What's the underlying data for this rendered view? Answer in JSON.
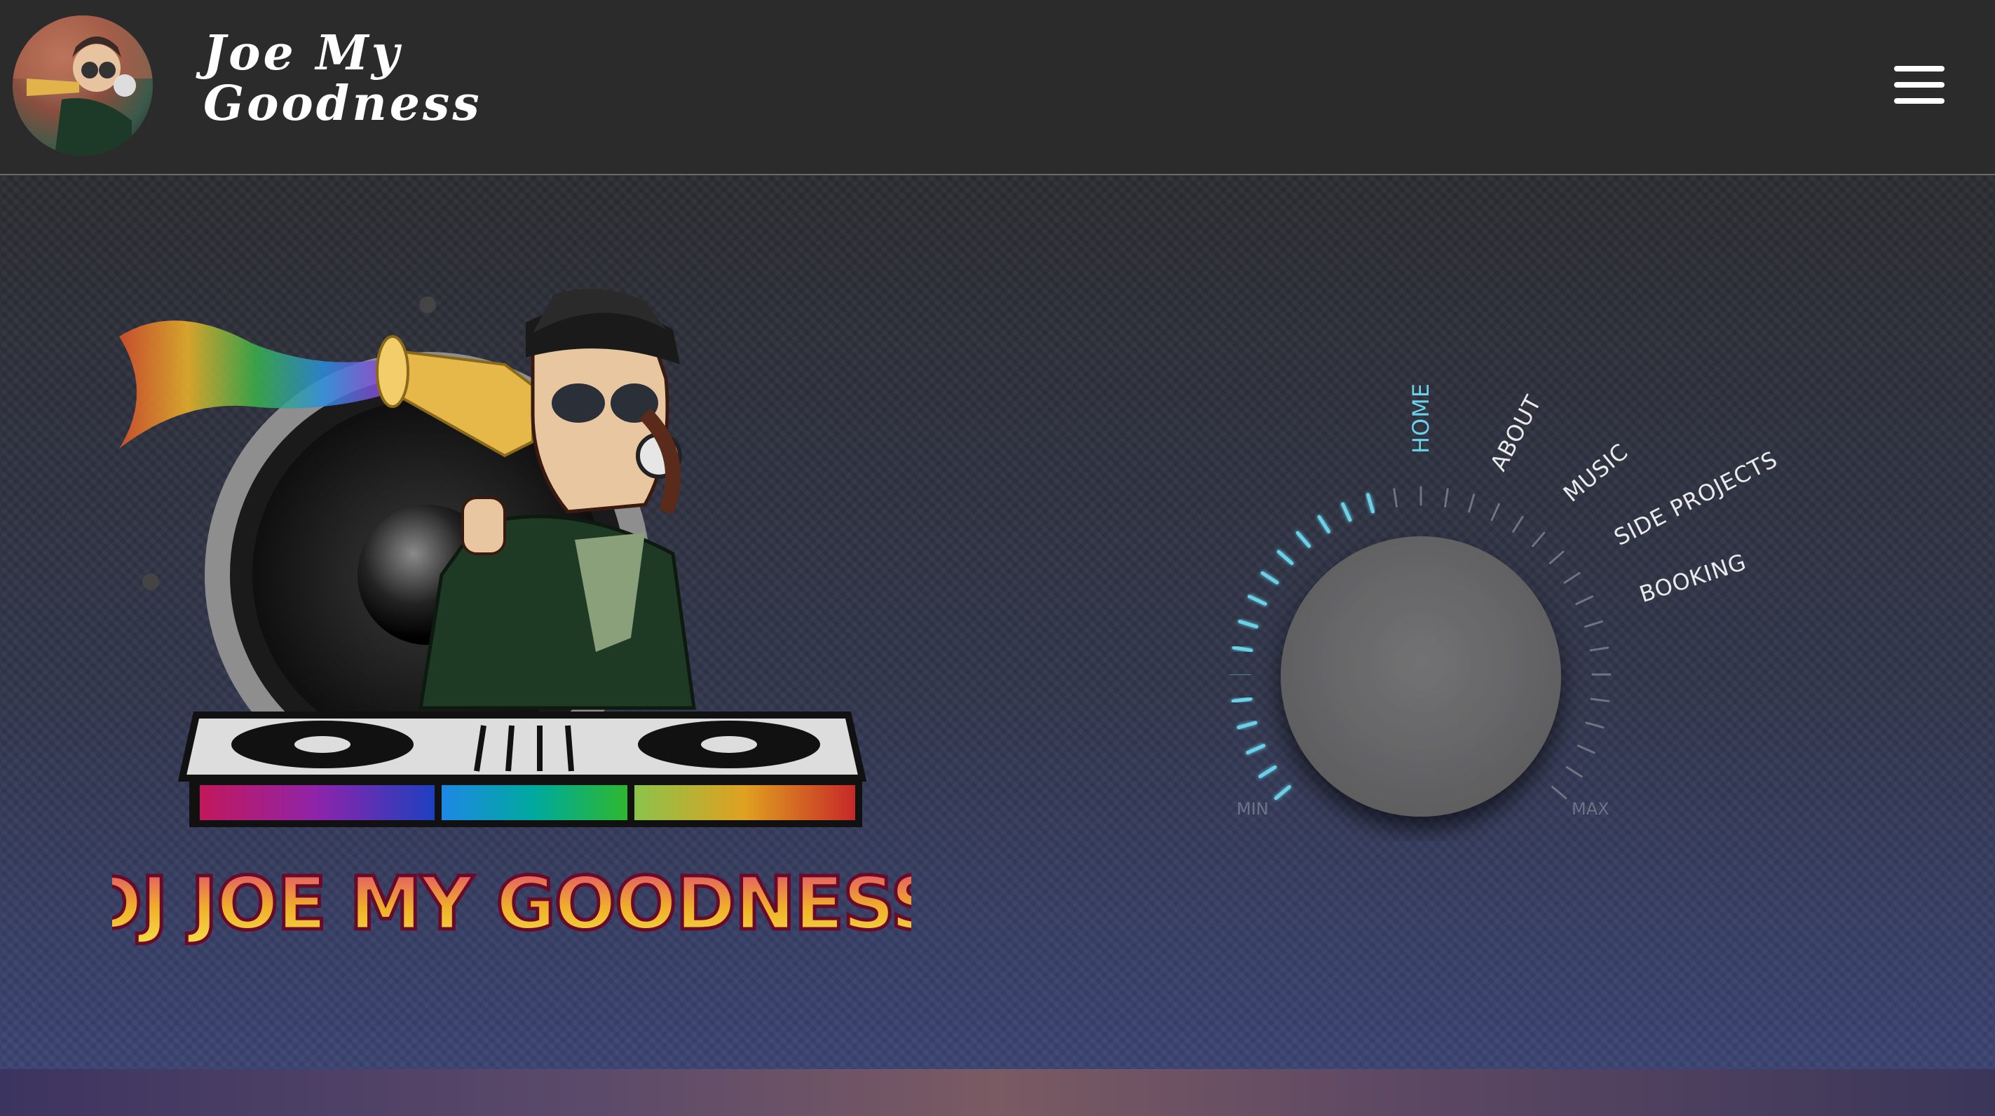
{
  "header": {
    "brand_line1": "Joe My",
    "brand_line2": "Goodness",
    "menu_icon": "hamburger-menu-icon"
  },
  "hero": {
    "logo_text": "DJ JOE MY GOODNESS"
  },
  "knob": {
    "nav_items": [
      {
        "label": "HOME",
        "active": true
      },
      {
        "label": "ABOUT",
        "active": false
      },
      {
        "label": "MUSIC",
        "active": false
      },
      {
        "label": "SIDE PROJECTS",
        "active": false
      },
      {
        "label": "BOOKING",
        "active": false
      }
    ],
    "min_label": "MIN",
    "max_label": "MAX"
  },
  "colors": {
    "accent": "#6ad1e8",
    "header_bg": "#2b2b2c",
    "knob": "#6b6b6d"
  }
}
